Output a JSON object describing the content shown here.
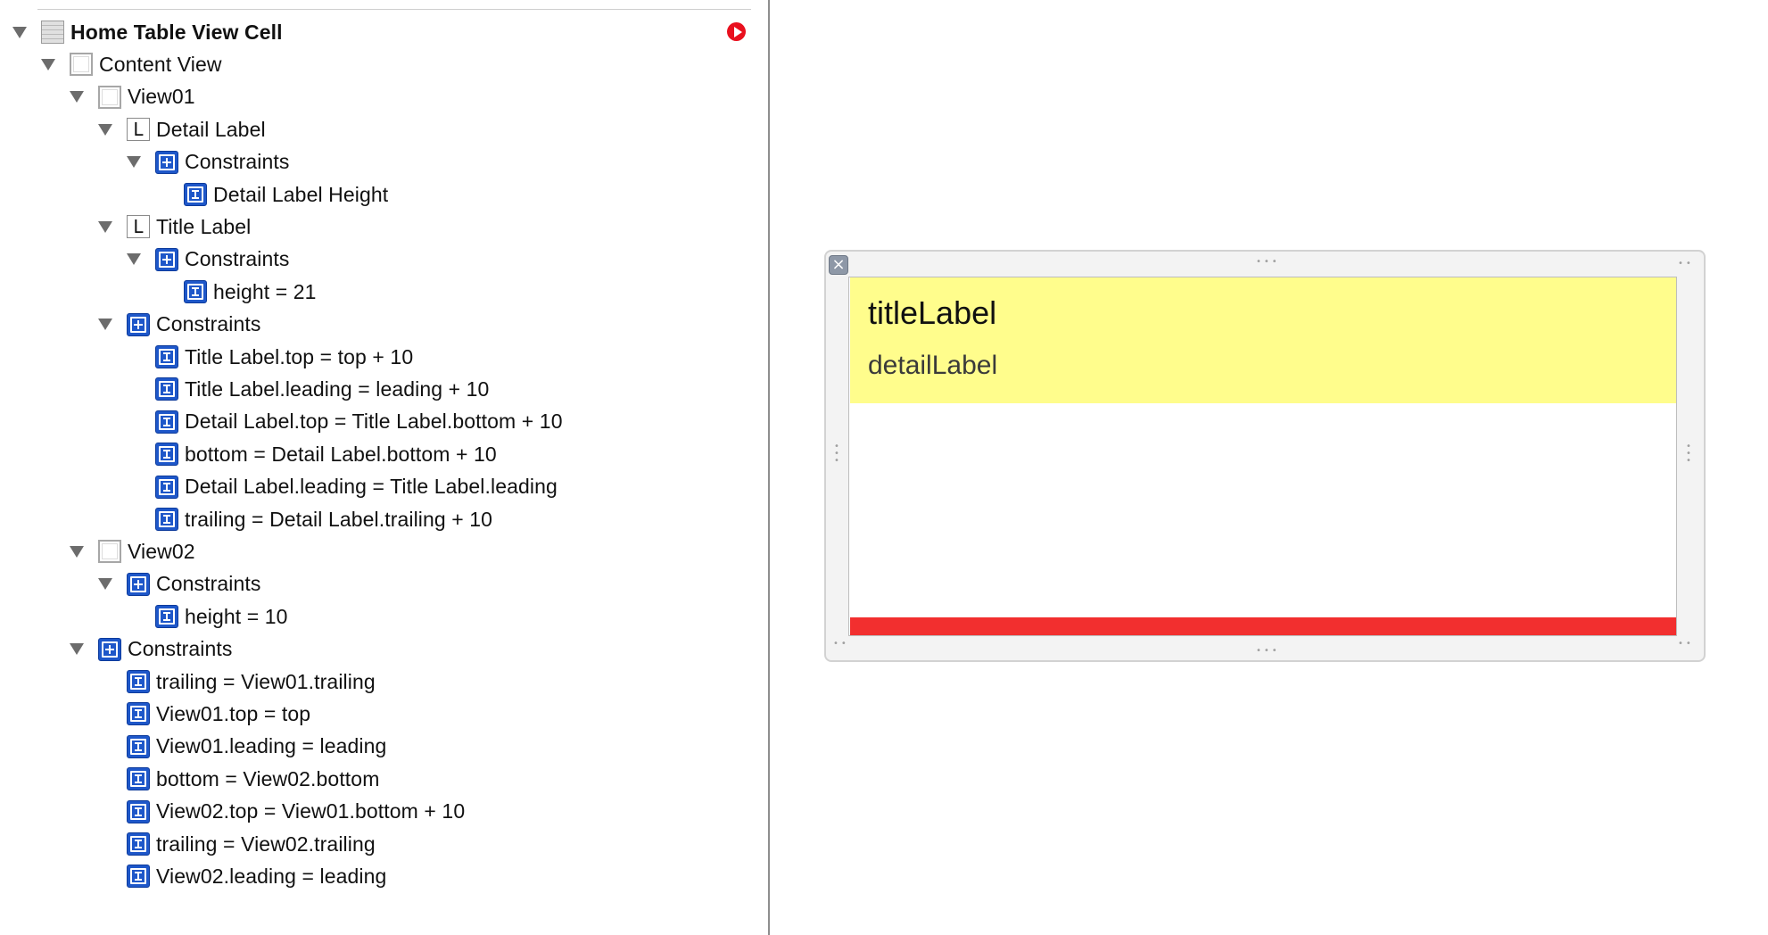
{
  "outline": {
    "items": [
      {
        "label": "Home Table View Cell",
        "depth": 0,
        "icon": "table-cell-icon",
        "disclosure": true,
        "bold": true
      },
      {
        "label": "Content View",
        "depth": 1,
        "icon": "view-icon",
        "disclosure": true
      },
      {
        "label": "View01",
        "depth": 2,
        "icon": "view-icon",
        "disclosure": true
      },
      {
        "label": "Detail Label",
        "depth": 3,
        "icon": "label-icon",
        "disclosure": true
      },
      {
        "label": "Constraints",
        "depth": 4,
        "icon": "constraints-icon",
        "disclosure": true
      },
      {
        "label": "Detail Label Height",
        "depth": 5,
        "icon": "height-constraint-icon",
        "disclosure": false
      },
      {
        "label": "Title Label",
        "depth": 3,
        "icon": "label-icon",
        "disclosure": true
      },
      {
        "label": "Constraints",
        "depth": 4,
        "icon": "constraints-icon",
        "disclosure": true
      },
      {
        "label": "height = 21",
        "depth": 5,
        "icon": "height-constraint-icon",
        "disclosure": false
      },
      {
        "label": "Constraints",
        "depth": 3,
        "icon": "constraints-icon",
        "disclosure": true
      },
      {
        "label": "Title Label.top = top + 10",
        "depth": 4,
        "icon": "top-constraint-icon",
        "disclosure": false
      },
      {
        "label": "Title Label.leading = leading + 10",
        "depth": 4,
        "icon": "leading-constraint-icon",
        "disclosure": false
      },
      {
        "label": "Detail Label.top = Title Label.bottom + 10",
        "depth": 4,
        "icon": "vertical-spacing-icon",
        "disclosure": false
      },
      {
        "label": "bottom = Detail Label.bottom + 10",
        "depth": 4,
        "icon": "bottom-constraint-icon",
        "disclosure": false
      },
      {
        "label": "Detail Label.leading = Title Label.leading",
        "depth": 4,
        "icon": "leading-align-icon",
        "disclosure": false
      },
      {
        "label": "trailing = Detail Label.trailing + 10",
        "depth": 4,
        "icon": "trailing-constraint-icon",
        "disclosure": false
      },
      {
        "label": "View02",
        "depth": 2,
        "icon": "view-icon",
        "disclosure": true
      },
      {
        "label": "Constraints",
        "depth": 3,
        "icon": "constraints-icon",
        "disclosure": true
      },
      {
        "label": "height = 10",
        "depth": 4,
        "icon": "height-constraint-icon",
        "disclosure": false
      },
      {
        "label": "Constraints",
        "depth": 2,
        "icon": "constraints-icon",
        "disclosure": true
      },
      {
        "label": "trailing = View01.trailing",
        "depth": 3,
        "icon": "trailing-constraint-icon",
        "disclosure": false
      },
      {
        "label": "View01.top = top",
        "depth": 3,
        "icon": "top-constraint-icon",
        "disclosure": false
      },
      {
        "label": "View01.leading = leading",
        "depth": 3,
        "icon": "leading-constraint-icon",
        "disclosure": false
      },
      {
        "label": "bottom = View02.bottom",
        "depth": 3,
        "icon": "bottom-constraint-icon",
        "disclosure": false
      },
      {
        "label": "View02.top = View01.bottom + 10",
        "depth": 3,
        "icon": "vertical-spacing-icon",
        "disclosure": false
      },
      {
        "label": "trailing = View02.trailing",
        "depth": 3,
        "icon": "trailing-constraint-icon",
        "disclosure": false
      },
      {
        "label": "View02.leading = leading",
        "depth": 3,
        "icon": "leading-constraint-icon",
        "disclosure": false
      }
    ],
    "warning_icon": "warning-arrow-icon"
  },
  "canvas": {
    "title_label": "titleLabel",
    "detail_label": "detailLabel",
    "colors": {
      "view01": "#fffd8c",
      "view02": "#f22f2f"
    }
  }
}
